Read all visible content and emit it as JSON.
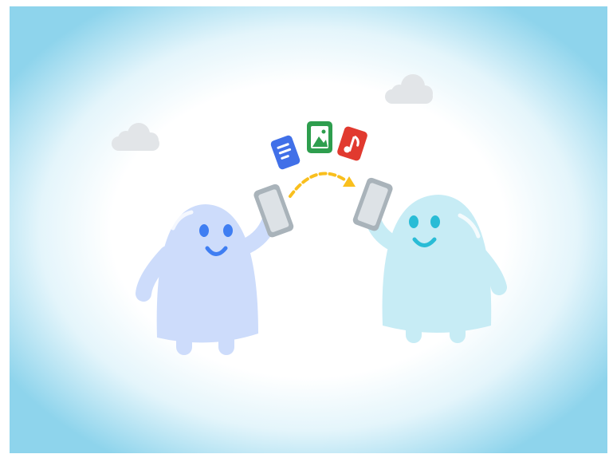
{
  "scene": {
    "colors": {
      "sky_edge": "#8ed4ec",
      "sky_center": "#ffffff",
      "cloud": "#e2e5e8",
      "left_character": "#cddcfb",
      "left_character_shade": "#bfd1f7",
      "left_face": "#3f7ef2",
      "right_character": "#c7ecf5",
      "right_character_shade": "#b6e3ef",
      "right_face": "#29bcd6",
      "phone_frame": "#a9b3ba",
      "phone_screen": "#dde2e6",
      "arrow": "#f9bf1d",
      "doc_icon": "#4170e8",
      "photo_icon": "#2e9e4e",
      "music_icon": "#e13a2f"
    },
    "icons": [
      "document-icon",
      "photo-icon",
      "music-icon"
    ]
  }
}
